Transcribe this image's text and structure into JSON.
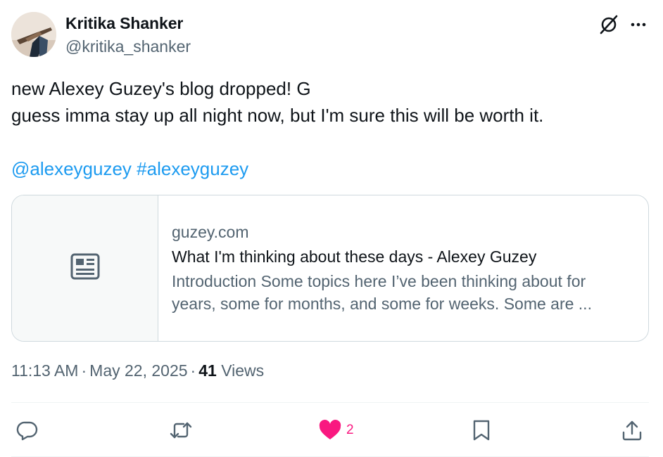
{
  "author": {
    "name": "Kritika Shanker",
    "handle": "@kritika_shanker"
  },
  "tweet": {
    "line1": "new Alexey Guzey's blog dropped! G",
    "line2": "guess imma stay up all night now, but I'm sure this will be worth it.",
    "mention": "@alexeyguzey",
    "hashtag": "#alexeyguzey"
  },
  "link_card": {
    "domain": "guzey.com",
    "title": "What I'm thinking about these days - Alexey Guzey",
    "description": "Introduction Some topics here I’ve been thinking about for years, some for months, and some for weeks. Some are ..."
  },
  "meta": {
    "time": "11:13 AM",
    "date": "May 22, 2025",
    "views_count": "41",
    "views_label": "Views"
  },
  "actions": {
    "like_count": "2"
  },
  "icons": {
    "grok": "grok-icon",
    "more": "more-icon",
    "card": "newspaper-icon",
    "reply": "reply-icon",
    "retweet": "retweet-icon",
    "like": "heart-icon",
    "bookmark": "bookmark-icon",
    "share": "share-icon"
  },
  "colors": {
    "link": "#1d9bf0",
    "secondary_text": "#536471",
    "like_active": "#f91880",
    "border": "#cfd9de"
  }
}
